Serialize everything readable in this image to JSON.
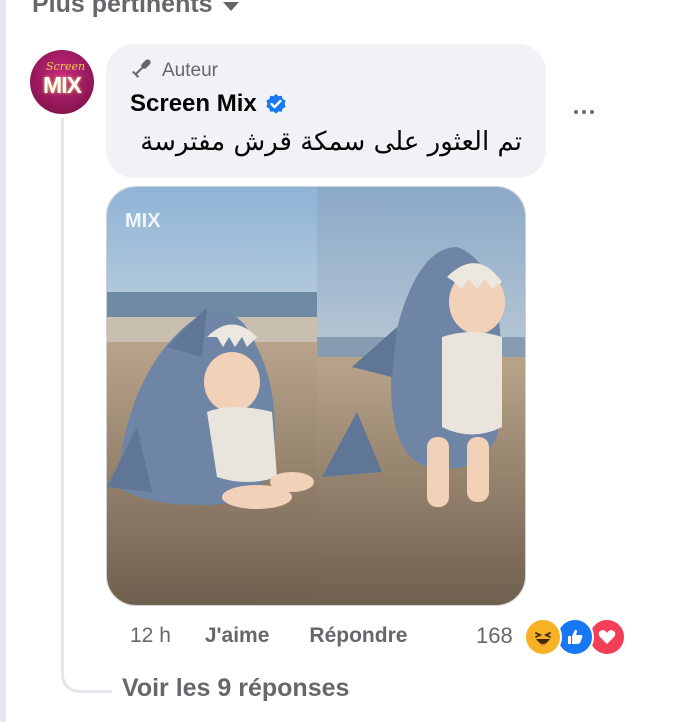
{
  "sort": {
    "label": "Plus pertinents",
    "icon": "caret-down-icon"
  },
  "comment": {
    "badge_icon": "microphone-icon",
    "badge_label": "Auteur",
    "author": "Screen Mix",
    "verified_icon": "verified-badge-icon",
    "text": "تم العثور على سمكة قرش مفترسة",
    "avatar_text": "MIX",
    "avatar_script": "Screen",
    "photo_watermark": "MIX",
    "time": "12 h",
    "like_label": "J'aime",
    "reply_label": "Répondre",
    "reaction_count": "168",
    "reactions": [
      "haha-reaction-icon",
      "like-reaction-icon",
      "love-reaction-icon"
    ]
  },
  "replies": {
    "label": "Voir les 9 réponses"
  },
  "colors": {
    "accent_blue": "#1877f2",
    "secondary_text": "#65676b",
    "bubble_bg": "#f0f2f5",
    "love_red": "#f33e58",
    "haha_yellow": "#f7b125"
  }
}
